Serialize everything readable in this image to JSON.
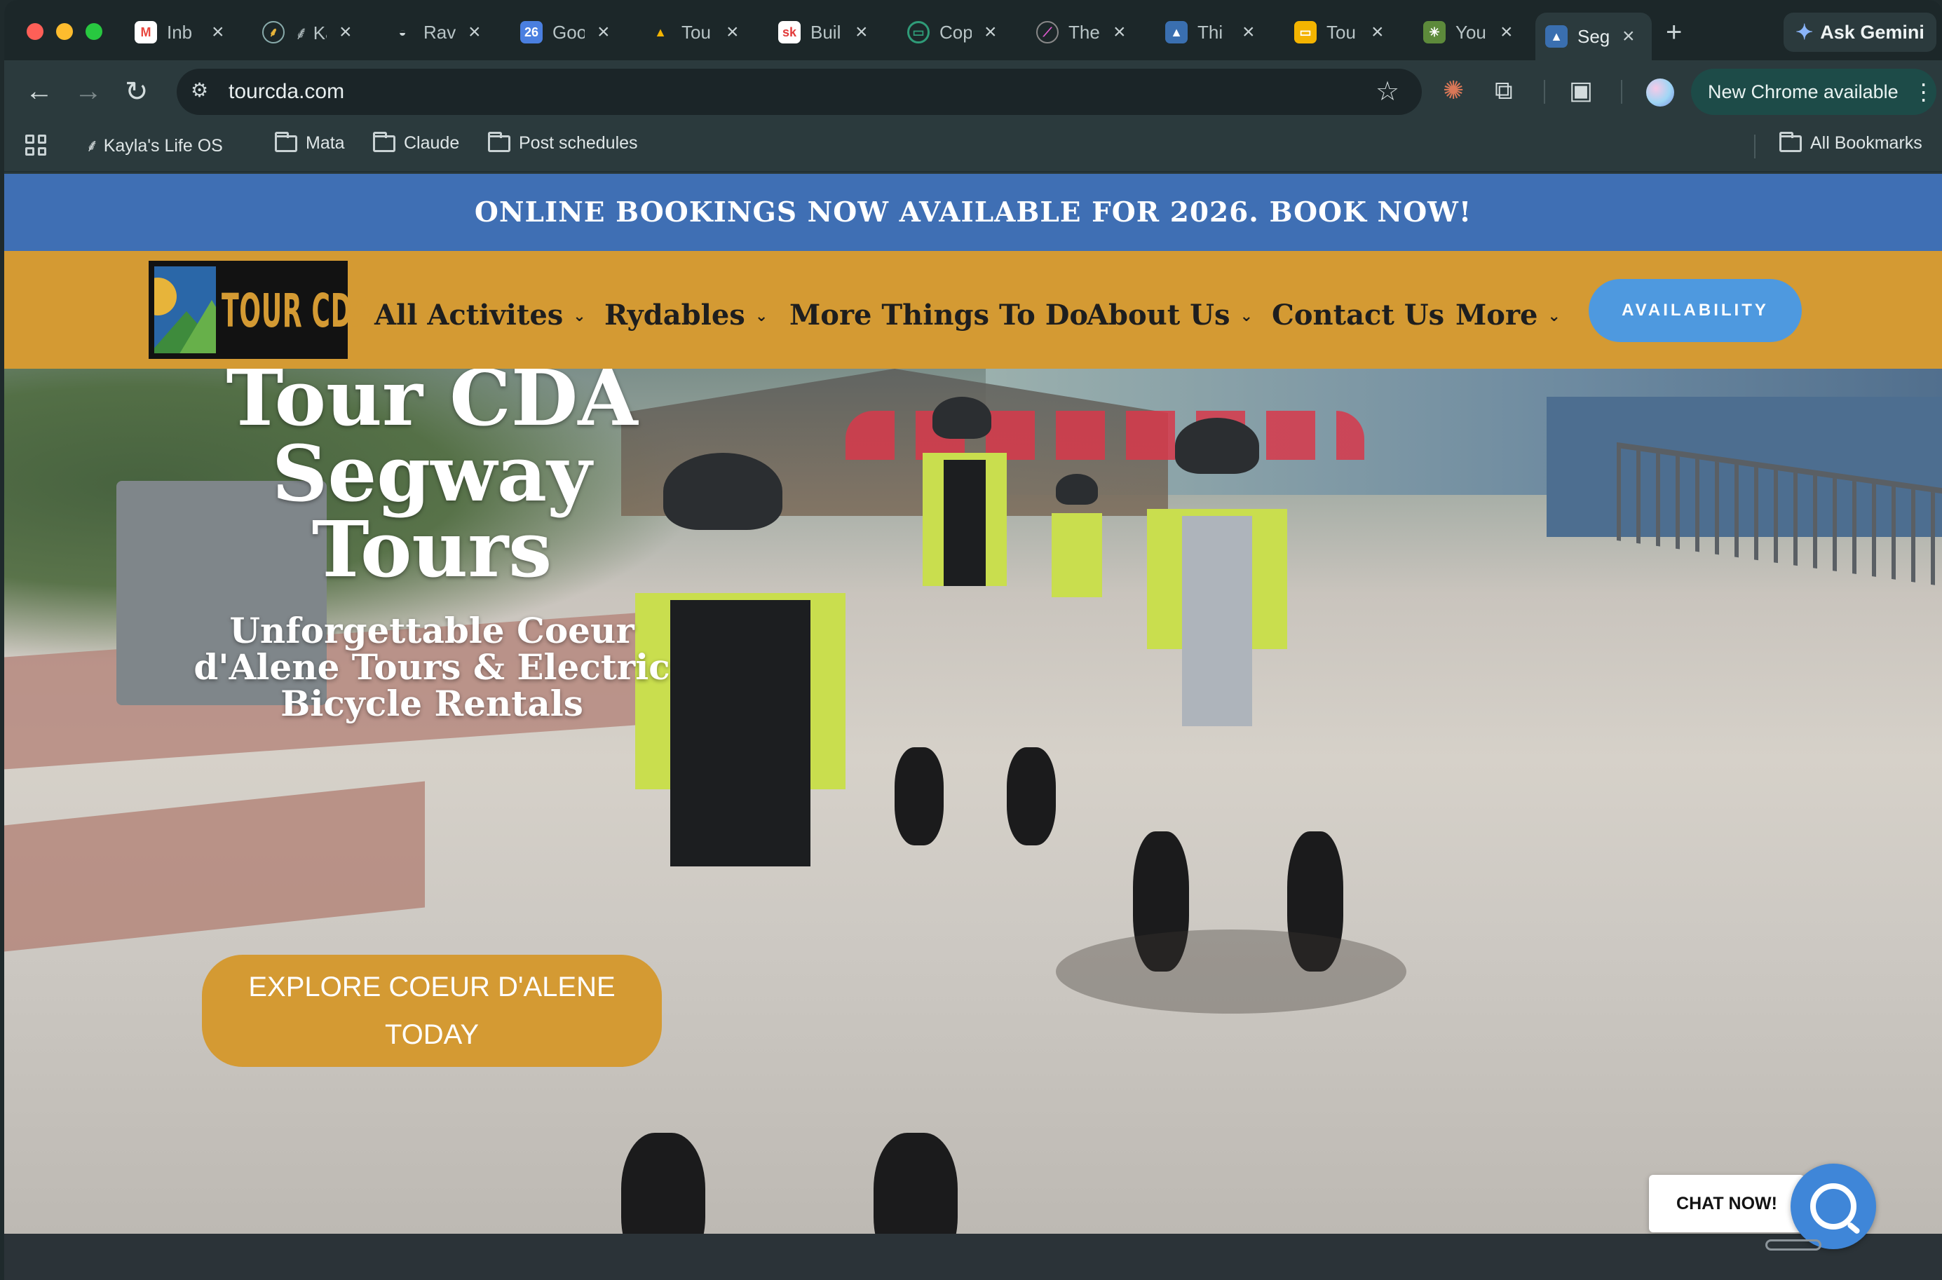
{
  "browser": {
    "tabs": [
      {
        "title": "Inb",
        "icon": "gmail-icon",
        "color": "#e8483f"
      },
      {
        "title": "⸙ Ka",
        "icon": "spark-tab-icon",
        "color": "#1c2729"
      },
      {
        "title": "Rav",
        "icon": "rav-icon",
        "color": "#1c2729"
      },
      {
        "title": "Goo",
        "icon": "calendar-icon",
        "color": "#4a7fe0"
      },
      {
        "title": "Tou",
        "icon": "drive-icon",
        "color": "#1c2729"
      },
      {
        "title": "Buil",
        "icon": "sk-icon",
        "color": "#e23b3b"
      },
      {
        "title": "Cop",
        "icon": "copilot-icon",
        "color": "#2f9b78"
      },
      {
        "title": "The",
        "icon": "the-icon",
        "color": "#1c2729"
      },
      {
        "title": "Thi",
        "icon": "image-icon",
        "color": "#3a6fb0"
      },
      {
        "title": "Tou",
        "icon": "slides-icon",
        "color": "#f4b400"
      },
      {
        "title": "You",
        "icon": "pattern-icon",
        "color": "#5d8a3b"
      },
      {
        "title": "Seg",
        "icon": "image-icon",
        "color": "#3a6fb0"
      }
    ],
    "ask_gemini": "Ask Gemini",
    "url": "tourcda.com",
    "update_label": "New Chrome available",
    "bookmarks": {
      "items": [
        "⸙ Kayla's Life OS",
        "Mata",
        "Claude",
        "Post schedules"
      ],
      "all_bookmarks": "All Bookmarks"
    }
  },
  "site": {
    "promo_banner": "ONLINE BOOKINGS NOW AVAILABLE FOR 2026. BOOK NOW!",
    "logo_text": "TOUR CDA",
    "nav": [
      {
        "label": "All Activites",
        "has_dropdown": true
      },
      {
        "label": "Rydables",
        "has_dropdown": true
      },
      {
        "label": "More Things To Do",
        "has_dropdown": false
      },
      {
        "label": "About Us",
        "has_dropdown": true
      },
      {
        "label": "Contact Us",
        "has_dropdown": false
      },
      {
        "label": "More",
        "has_dropdown": true
      }
    ],
    "availability_button": "AVAILABILITY",
    "hero": {
      "title": "Tour CDA Segway Tours",
      "subtitle": "Unforgettable Coeur d'Alene Tours & Electric Bicycle Rentals",
      "cta": "EXPLORE COEUR D'ALENE TODAY"
    },
    "chat_label": "CHAT NOW!"
  },
  "colors": {
    "promo_blue": "#3f6fb4",
    "header_gold": "#d49a33",
    "availability_blue": "#4e99df",
    "chat_blue": "#3f86d8"
  }
}
